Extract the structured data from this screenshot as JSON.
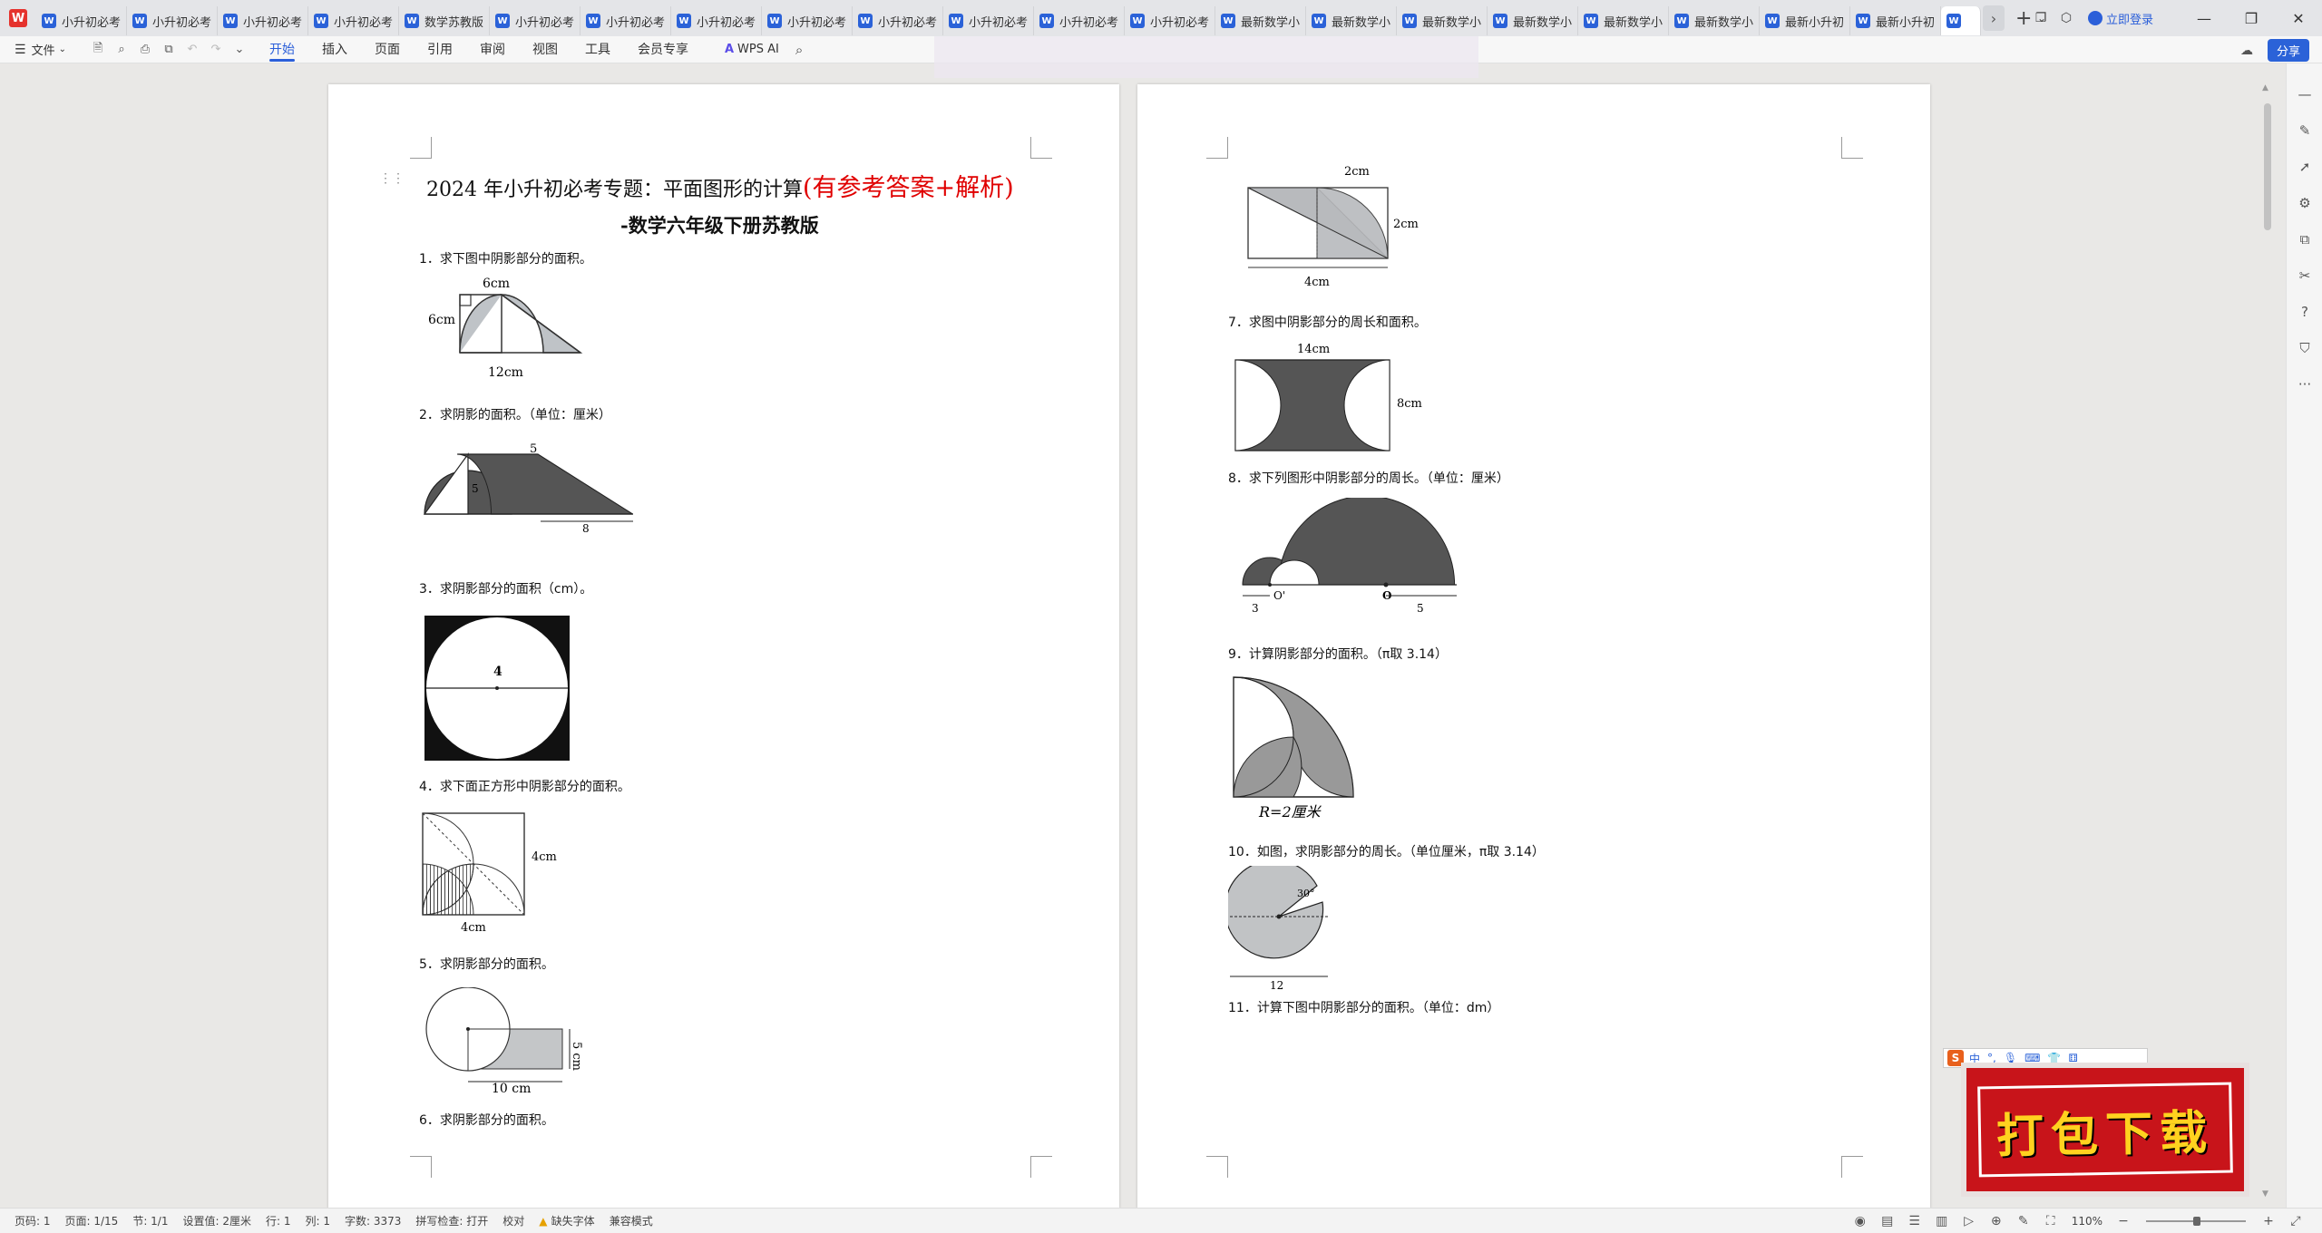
{
  "app": {
    "logo_letter": "W",
    "brand_color": "#e5322d",
    "accent_color": "#2b5fd9"
  },
  "tabs": [
    {
      "label": "小升初必考",
      "icon": "W"
    },
    {
      "label": "小升初必考",
      "icon": "W"
    },
    {
      "label": "小升初必考",
      "icon": "W"
    },
    {
      "label": "小升初必考",
      "icon": "W"
    },
    {
      "label": "数学苏教版",
      "icon": "W"
    },
    {
      "label": "小升初必考",
      "icon": "W"
    },
    {
      "label": "小升初必考",
      "icon": "W"
    },
    {
      "label": "小升初必考",
      "icon": "W"
    },
    {
      "label": "小升初必考",
      "icon": "W"
    },
    {
      "label": "小升初必考",
      "icon": "W"
    },
    {
      "label": "小升初必考",
      "icon": "W"
    },
    {
      "label": "小升初必考",
      "icon": "W"
    },
    {
      "label": "小升初必考",
      "icon": "W"
    },
    {
      "label": "最新数学小",
      "icon": "W"
    },
    {
      "label": "最新数学小",
      "icon": "W"
    },
    {
      "label": "最新数学小",
      "icon": "W"
    },
    {
      "label": "最新数学小",
      "icon": "W"
    },
    {
      "label": "最新数学小",
      "icon": "W"
    },
    {
      "label": "最新数学小",
      "icon": "W"
    },
    {
      "label": "最新小升初",
      "icon": "W"
    },
    {
      "label": "最新小升初",
      "icon": "W"
    }
  ],
  "tabbar": {
    "login_label": "立即登录",
    "add_tab": "+"
  },
  "menubar": {
    "file_label": "文件",
    "tabs": [
      "开始",
      "插入",
      "页面",
      "引用",
      "审阅",
      "视图",
      "工具",
      "会员专享"
    ],
    "ai_label": "WPS AI",
    "share_label": "分享"
  },
  "document": {
    "title_main": "2024 年小升初必考专题：平面图形的计算",
    "title_red": "(有参考答案+解析)",
    "subtitle": "-数学六年级下册苏教版",
    "questions_page1": [
      "1．求下图中阴影部分的面积。",
      "2．求阴影的面积。（单位：厘米）",
      "3．求阴影部分的面积（cm）。",
      "4．求下面正方形中阴影部分的面积。",
      "5．求阴影部分的面积。",
      "6．求阴影部分的面积。"
    ],
    "questions_page2": [
      "7．求图中阴影部分的周长和面积。",
      "8．求下列图形中阴影部分的周长。（单位：厘米）",
      "9．计算阴影部分的面积。（π取 3.14）",
      "10．如图，求阴影部分的周长。（单位厘米，π取 3.14）",
      "11．计算下图中阴影部分的面积。（单位：dm）"
    ],
    "fig_labels": {
      "f1_top": "6cm",
      "f1_left": "6cm",
      "f1_bottom": "12cm",
      "f2_top": "5",
      "f2_mid": "5",
      "f2_bottom": "8",
      "f3_center": "4",
      "f4_right": "4cm",
      "f4_bottom": "4cm",
      "f5_bottom": "10 cm",
      "f5_right": "5 cm",
      "f6_top": "2cm",
      "f6_right": "2cm",
      "f6_bottom": "4cm",
      "f7_top": "14cm",
      "f7_right": "8cm",
      "f8_o1": "O'",
      "f8_o2": "O",
      "f8_left": "3",
      "f8_right": "5",
      "f9_bottom": "R=2厘米",
      "f10_angle": "30°",
      "f10_bottom": "12"
    }
  },
  "ime": {
    "logo": "S",
    "mode": "中"
  },
  "download_banner": {
    "label": "打包下载"
  },
  "statusbar": {
    "page_num": "页码: 1",
    "pages": "页面: 1/15",
    "section": "节: 1/1",
    "setting": "设置值: 2厘米",
    "row": "行: 1",
    "col": "列: 1",
    "word_count": "字数: 3373",
    "spell": "拼写检查: 打开",
    "proof": "校对",
    "missing_font": "缺失字体",
    "compat": "兼容模式",
    "zoom": "110%"
  }
}
